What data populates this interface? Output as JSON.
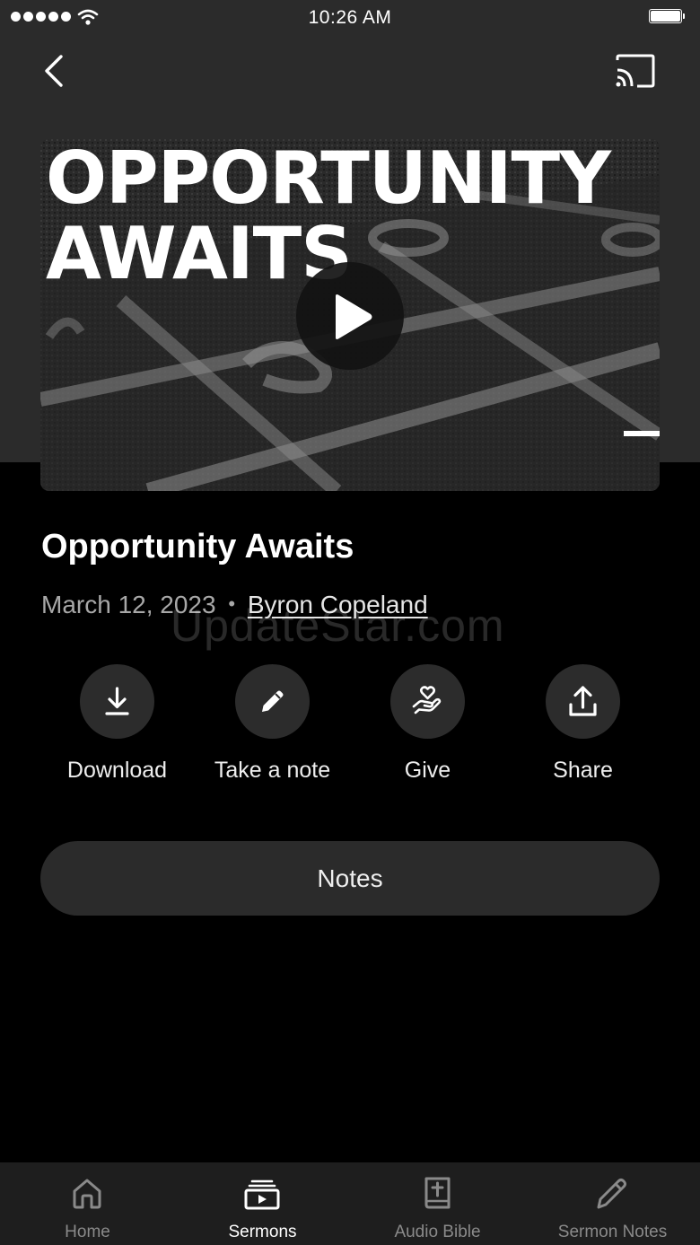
{
  "status_bar": {
    "time": "10:26 AM",
    "signal_icon": "signal-dots-icon",
    "wifi_icon": "wifi-icon",
    "battery_icon": "battery-icon"
  },
  "nav": {
    "back_icon": "chevron-left-icon",
    "cast_icon": "cast-icon"
  },
  "hero": {
    "title_line1": "OPPORTUNITY",
    "title_line2": "AWAITS",
    "play_icon": "play-icon"
  },
  "sermon": {
    "title": "Opportunity Awaits",
    "date": "March 12, 2023",
    "separator": "•",
    "speaker": "Byron Copeland"
  },
  "watermark": "UpdateStar.com",
  "actions": [
    {
      "label": "Download",
      "icon": "download-icon"
    },
    {
      "label": "Take a note",
      "icon": "pencil-icon"
    },
    {
      "label": "Give",
      "icon": "heart-hand-icon"
    },
    {
      "label": "Share",
      "icon": "share-icon"
    }
  ],
  "notes_button": {
    "label": "Notes"
  },
  "tabs": [
    {
      "label": "Home",
      "icon": "home-icon",
      "active": false
    },
    {
      "label": "Sermons",
      "icon": "sermons-icon",
      "active": true
    },
    {
      "label": "Audio Bible",
      "icon": "bible-icon",
      "active": false
    },
    {
      "label": "Sermon Notes",
      "icon": "pencil-icon",
      "active": false
    }
  ],
  "colors": {
    "background": "#000000",
    "top_band": "#2b2b2b",
    "button_bg": "#2c2c2c",
    "tab_bar_bg": "#1e1e1e",
    "muted_text": "#a8a8a8",
    "inactive_tab": "#8a8a8a"
  }
}
